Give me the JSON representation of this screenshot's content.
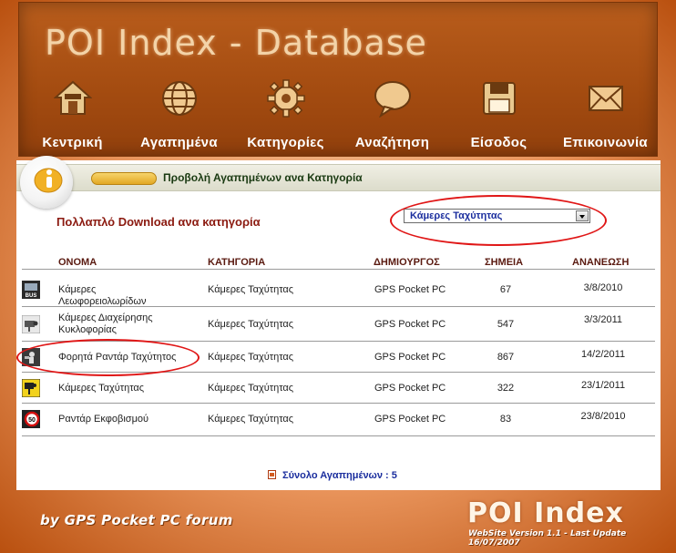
{
  "header": {
    "title": "POI Index - Database",
    "nav": [
      {
        "label": "Κεντρική",
        "icon": "home-icon"
      },
      {
        "label": "Αγαπημένα",
        "icon": "globe-icon"
      },
      {
        "label": "Κατηγορίες",
        "icon": "gear-icon"
      },
      {
        "label": "Αναζήτηση",
        "icon": "speech-bubble-icon"
      },
      {
        "label": "Είσοδος",
        "icon": "save-disk-icon"
      },
      {
        "label": "Επικοινωνία",
        "icon": "envelope-icon"
      }
    ]
  },
  "section": {
    "title": "Προβολή Αγαπημένων ανα Κατηγορία",
    "multi_download_label": "Πολλαπλό Download ανα κατηγορία",
    "category_select_value": "Κάμερες Ταχύτητας"
  },
  "table": {
    "headers": [
      "ΟΝΟΜΑ",
      "ΚΑΤΗΓΟΡΙΑ",
      "ΔΗΜΙΟΥΡΓΟΣ",
      "ΣΗΜΕΙΑ",
      "ΑΝΑΝΕΩΣΗ"
    ],
    "rows": [
      {
        "icon": "bus-icon",
        "name": "Κάμερες Λεωφορειολωρίδων",
        "category": "Κάμερες Ταχύτητας",
        "creator": "GPS Pocket PC",
        "points": "67",
        "updated": "3/8/2010"
      },
      {
        "icon": "traffic-camera-icon",
        "name": "Κάμερες Διαχείρησης Κυκλοφορίας",
        "category": "Κάμερες Ταχύτητας",
        "creator": "GPS Pocket PC",
        "points": "547",
        "updated": "3/3/2011"
      },
      {
        "icon": "mobile-radar-icon",
        "name": "Φορητά Ραντάρ Ταχύτητος",
        "category": "Κάμερες Ταχύτητας",
        "creator": "GPS Pocket PC",
        "points": "867",
        "updated": "14/2/2011"
      },
      {
        "icon": "speed-camera-icon",
        "name": "Κάμερες Ταχύτητας",
        "category": "Κάμερες Ταχύτητας",
        "creator": "GPS Pocket PC",
        "points": "322",
        "updated": "23/1/2011"
      },
      {
        "icon": "speed-limit-sign-icon",
        "name": "Ραντάρ Εκφοβισμού",
        "category": "Κάμερες Ταχύτητας",
        "creator": "GPS Pocket PC",
        "points": "83",
        "updated": "23/8/2010"
      }
    ],
    "total_label": "Σύνολο Αγαπημένων : 5"
  },
  "footer": {
    "credit": "by GPS Pocket PC forum",
    "logo": "POI Index",
    "version": "WebSite Version 1.1 -  Last Update 16/07/2007"
  },
  "colors": {
    "brand_orange": "#c45c14",
    "header_brown": "#a34b10",
    "link_blue": "#1b2e9e",
    "title_red": "#8b1a10",
    "annotation_red": "#e01616"
  }
}
